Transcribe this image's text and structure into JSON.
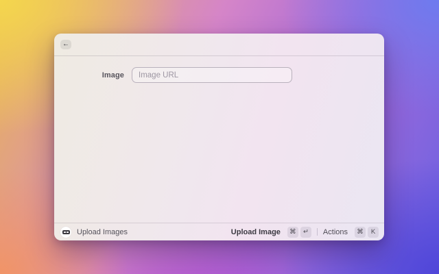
{
  "window": {
    "header": {
      "back_icon": "←"
    },
    "form": {
      "image_label": "Image",
      "image_url_value": "",
      "image_url_placeholder": "Image URL"
    },
    "footer": {
      "app_icon": "upload-images-extension-icon",
      "app_name": "Upload Images",
      "primary_action": {
        "label": "Upload Image",
        "keys": [
          "⌘",
          "↵"
        ]
      },
      "secondary_action": {
        "label": "Actions",
        "keys": [
          "⌘",
          "K"
        ]
      }
    }
  },
  "colors": {
    "bg_yellow": "#f4d64e",
    "bg_orange": "#f29464",
    "bg_magenta": "#b248ce",
    "bg_blue": "#6c7cf0",
    "bg_indigo": "#4e44d8",
    "window_tint_left": "#efebe2",
    "window_tint_right": "#eae6f2",
    "input_border": "#b9b1bc",
    "text_primary": "#3c3a42",
    "text_secondary": "#54515a",
    "placeholder": "#9d96a2"
  }
}
